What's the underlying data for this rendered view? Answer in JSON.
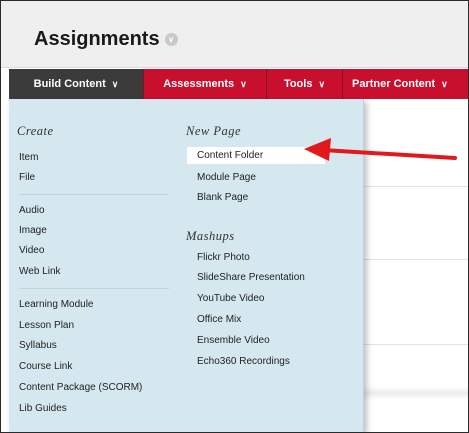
{
  "page": {
    "title": "Assignments",
    "title_icon": "chevron-circle-icon"
  },
  "tabs": [
    {
      "label": "Build Content",
      "active": true
    },
    {
      "label": "Assessments",
      "active": false
    },
    {
      "label": "Tools",
      "active": false
    },
    {
      "label": "Partner Content",
      "active": false
    }
  ],
  "menu": {
    "create": {
      "heading": "Create",
      "group1": [
        "Item",
        "File"
      ],
      "group2": [
        "Audio",
        "Image",
        "Video",
        "Web Link"
      ],
      "group3": [
        "Learning Module",
        "Lesson Plan",
        "Syllabus",
        "Course Link",
        "Content Package (SCORM)",
        "Lib Guides"
      ]
    },
    "new_page": {
      "heading": "New Page",
      "items": [
        "Content Folder",
        "Module Page",
        "Blank Page"
      ]
    },
    "mashups": {
      "heading": "Mashups",
      "items": [
        "Flickr Photo",
        "SlideShare Presentation",
        "YouTube Video",
        "Office Mix",
        "Ensemble Video",
        "Echo360 Recordings"
      ]
    }
  },
  "colors": {
    "tab_bar": "#c8102e",
    "active_tab": "#3b3b3b",
    "menu_background": "#d6e8ef",
    "annotation_arrow": "#e0191c"
  },
  "annotation": {
    "type": "arrow",
    "points_to": "Content Folder"
  }
}
